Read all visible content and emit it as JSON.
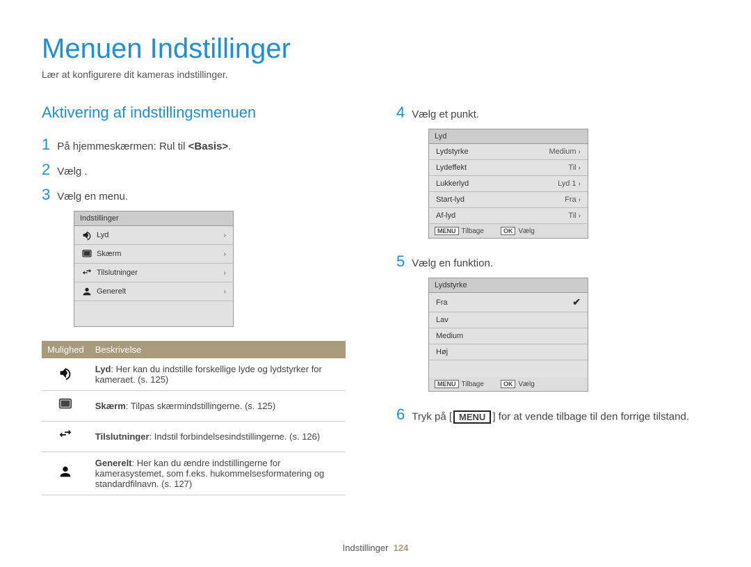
{
  "page": {
    "title": "Menuen Indstillinger",
    "subtitle": "Lær at konfigurere dit kameras indstillinger.",
    "footer_section": "Indstillinger",
    "footer_page": "124"
  },
  "left": {
    "section_title": "Aktivering af indstillingsmenuen",
    "steps": {
      "s1_num": "1",
      "s1_pre": "På hjemmeskærmen: Rul til ",
      "s1_bold": "<Basis>",
      "s1_post": ".",
      "s2_num": "2",
      "s2_text": "Vælg    .",
      "s3_num": "3",
      "s3_text": "Vælg en menu."
    },
    "menu": {
      "header": "Indstillinger",
      "items": [
        {
          "label": "Lyd",
          "icon": "speaker"
        },
        {
          "label": "Skærm",
          "icon": "screen"
        },
        {
          "label": "Tilslutninger",
          "icon": "arrows"
        },
        {
          "label": "Generelt",
          "icon": "person"
        }
      ]
    },
    "table": {
      "col1": "Mulighed",
      "col2": "Beskrivelse",
      "rows": [
        {
          "icon": "speaker",
          "label": "Lyd",
          "desc": ": Her kan du indstille forskellige lyde og lydstyrker for kameraet. (s. 125)"
        },
        {
          "icon": "screen",
          "label": "Skærm",
          "desc": ": Tilpas skærmindstillingerne. (s. 125)"
        },
        {
          "icon": "arrows",
          "label": "Tilslutninger",
          "desc": ": Indstil forbindelsesindstillingerne. (s. 126)"
        },
        {
          "icon": "person",
          "label": "Generelt",
          "desc": ": Her kan du ændre indstillingerne for kamerasystemet, som f.eks. hukommelsesformatering og standardfilnavn. (s. 127)"
        }
      ]
    }
  },
  "right": {
    "steps": {
      "s4_num": "4",
      "s4_text": "Vælg et punkt.",
      "s5_num": "5",
      "s5_text": "Vælg en funktion.",
      "s6_num": "6",
      "s6_pre": "Tryk på [",
      "s6_btn": "MENU",
      "s6_post": "] for at vende tilbage til den forrige tilstand."
    },
    "lyd_menu": {
      "header": "Lyd",
      "rows": [
        {
          "label": "Lydstyrke",
          "value": "Medium"
        },
        {
          "label": "Lydeffekt",
          "value": "Til"
        },
        {
          "label": "Lukkerlyd",
          "value": "Lyd 1"
        },
        {
          "label": "Start-lyd",
          "value": "Fra"
        },
        {
          "label": "Af-lyd",
          "value": "Til"
        }
      ],
      "footer": {
        "back_btn": "MENU",
        "back": "Tilbage",
        "ok_btn": "OK",
        "ok": "Vælg"
      }
    },
    "vol_menu": {
      "header": "Lydstyrke",
      "options": [
        {
          "label": "Fra",
          "checked": true
        },
        {
          "label": "Lav",
          "checked": false
        },
        {
          "label": "Medium",
          "checked": false
        },
        {
          "label": "Høj",
          "checked": false
        }
      ],
      "footer": {
        "back_btn": "MENU",
        "back": "Tilbage",
        "ok_btn": "OK",
        "ok": "Vælg"
      }
    }
  }
}
